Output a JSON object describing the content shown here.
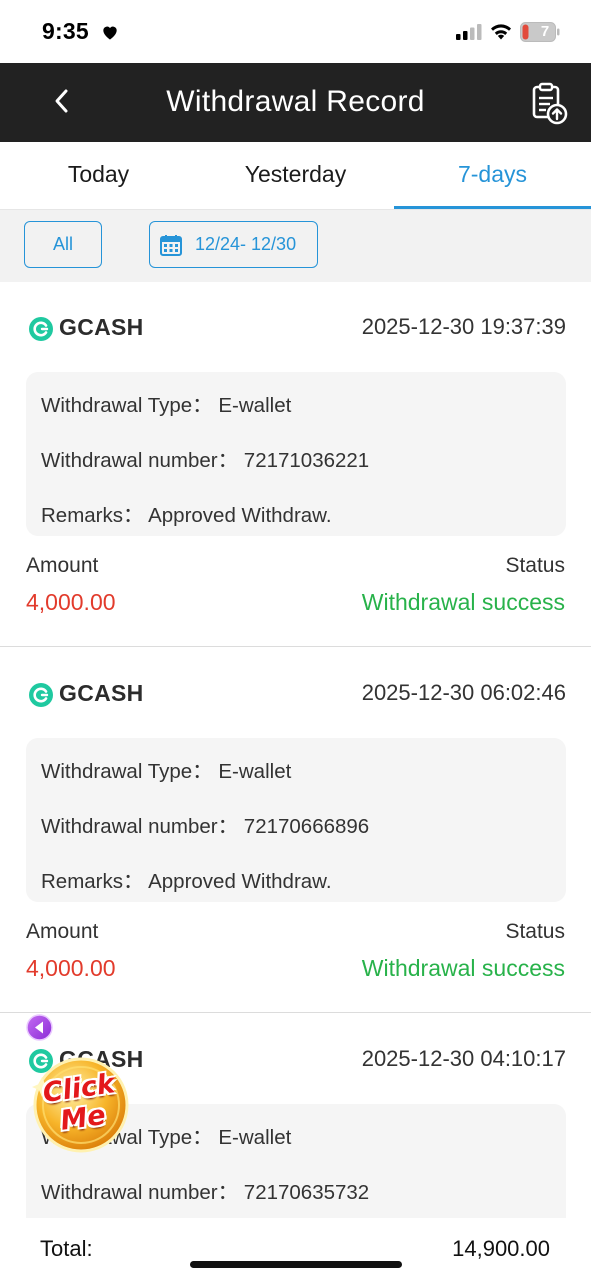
{
  "status_bar": {
    "time": "9:35",
    "battery": "7"
  },
  "header": {
    "title": "Withdrawal Record"
  },
  "tabs": [
    {
      "label": "Today",
      "active": false
    },
    {
      "label": "Yesterday",
      "active": false
    },
    {
      "label": "7-days",
      "active": true
    }
  ],
  "filters": {
    "all_label": "All",
    "date_range": "12/24- 12/30"
  },
  "labels": {
    "withdrawal_type": "Withdrawal Type：",
    "withdrawal_number": "Withdrawal number：",
    "remarks": "Remarks：",
    "amount": "Amount",
    "status": "Status"
  },
  "records": [
    {
      "provider": "GCASH",
      "datetime": "2025-12-30 19:37:39",
      "type": "E-wallet",
      "number": "72171036221",
      "remarks": "Approved Withdraw.",
      "amount": "4,000.00",
      "status": "Withdrawal success"
    },
    {
      "provider": "GCASH",
      "datetime": "2025-12-30 06:02:46",
      "type": "E-wallet",
      "number": "72170666896",
      "remarks": "Approved Withdraw.",
      "amount": "4,000.00",
      "status": "Withdrawal success"
    },
    {
      "provider": "GCASH",
      "datetime": "2025-12-30 04:10:17",
      "type": "E-wallet",
      "number": "72170635732",
      "remarks": "",
      "amount": "",
      "status": ""
    }
  ],
  "floating": {
    "click_me_text": "Click Me"
  },
  "total": {
    "label": "Total:",
    "value": "14,900.00"
  },
  "colors": {
    "accent": "#2694d8",
    "header_bg": "#222222",
    "amount": "#e23b2c",
    "success": "#28b24a",
    "gcash": "#1fc9a0"
  }
}
